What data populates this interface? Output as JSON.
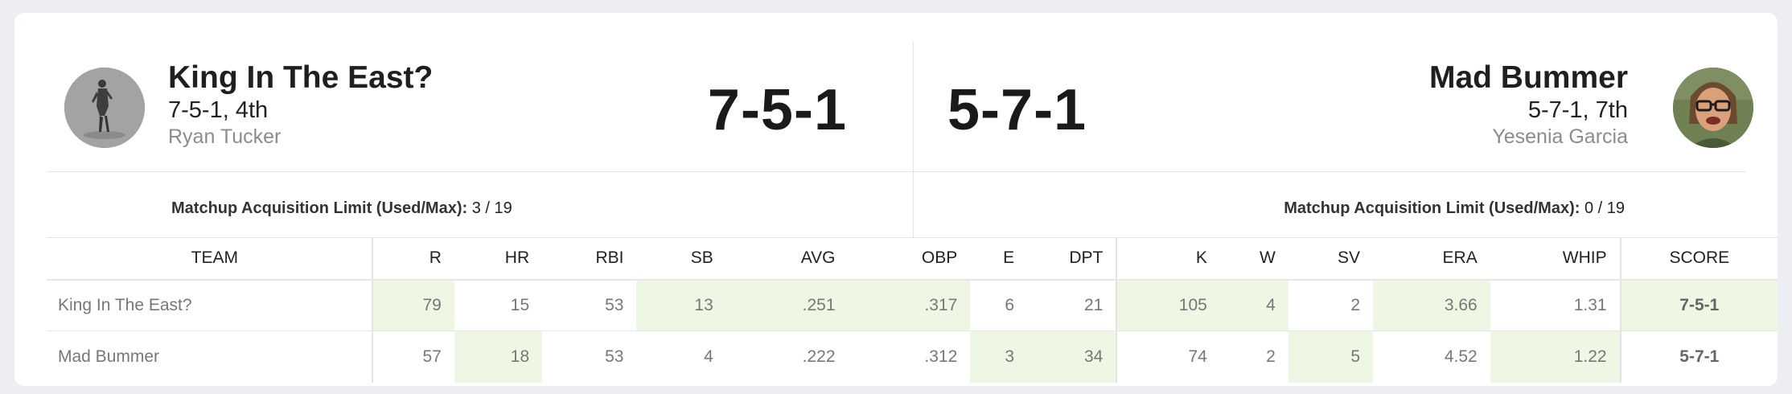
{
  "left_team": {
    "name": "King In The East?",
    "record_rank": "7-5-1, 4th",
    "owner": "Ryan Tucker",
    "score": "7-5-1",
    "acq_label": "Matchup Acquisition Limit (Used/Max):",
    "acq_value": "3 / 19"
  },
  "right_team": {
    "name": "Mad Bummer",
    "record_rank": "5-7-1, 7th",
    "owner": "Yesenia Garcia",
    "score": "5-7-1",
    "acq_label": "Matchup Acquisition Limit (Used/Max):",
    "acq_value": "0 / 19"
  },
  "table": {
    "headers": [
      "TEAM",
      "R",
      "HR",
      "RBI",
      "SB",
      "AVG",
      "OBP",
      "E",
      "DPT",
      "K",
      "W",
      "SV",
      "ERA",
      "WHIP",
      "SCORE"
    ],
    "rows": [
      {
        "team": "King In The East?",
        "values": [
          "79",
          "15",
          "53",
          "13",
          ".251",
          ".317",
          "6",
          "21",
          "105",
          "4",
          "2",
          "3.66",
          "1.31"
        ],
        "score": "7-5-1",
        "wins": [
          true,
          false,
          false,
          true,
          true,
          true,
          false,
          false,
          true,
          true,
          false,
          true,
          false
        ]
      },
      {
        "team": "Mad Bummer",
        "values": [
          "57",
          "18",
          "53",
          "4",
          ".222",
          ".312",
          "3",
          "34",
          "74",
          "2",
          "5",
          "4.52",
          "1.22"
        ],
        "score": "5-7-1",
        "wins": [
          false,
          true,
          false,
          false,
          false,
          false,
          true,
          true,
          false,
          false,
          true,
          false,
          true
        ]
      }
    ]
  },
  "colors": {
    "win_highlight": "#eef7e4",
    "score_winner_highlight": "#eef7e4"
  },
  "icons": {
    "left_avatar": "team-logo-figure",
    "right_avatar": "team-logo-portrait"
  }
}
